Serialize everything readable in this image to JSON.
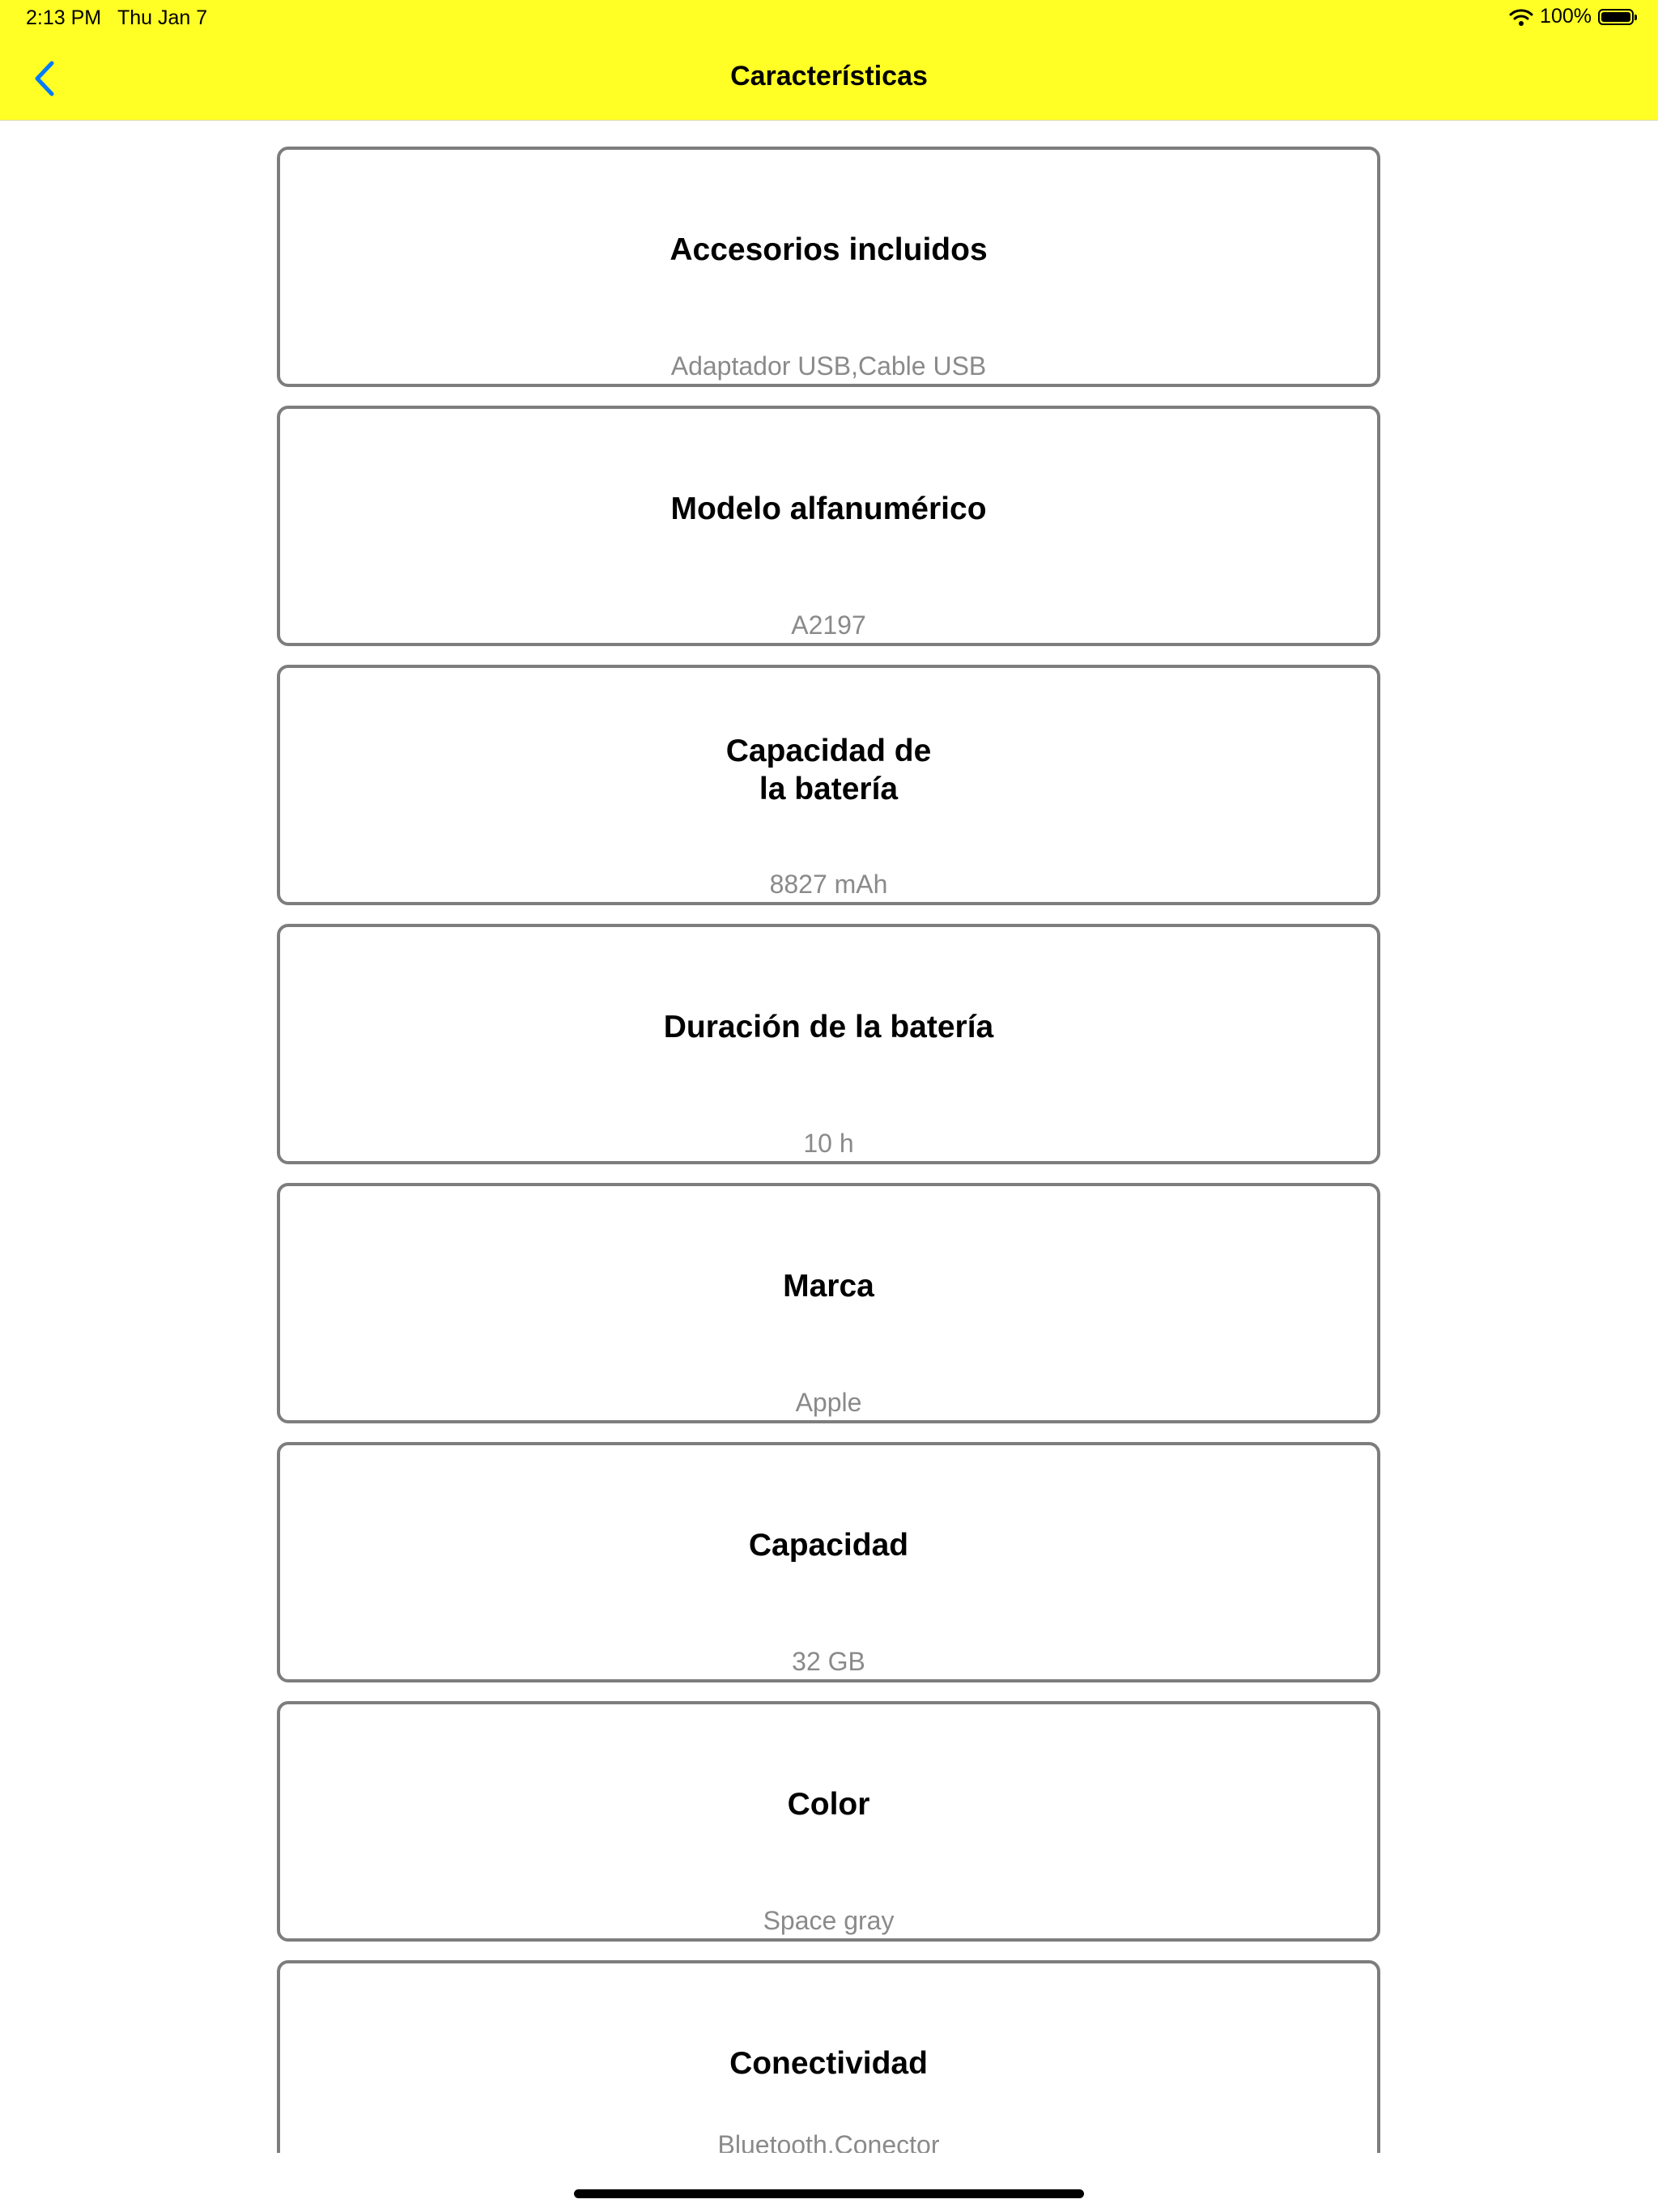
{
  "status_bar": {
    "time": "2:13 PM",
    "date": "Thu Jan 7",
    "battery": "100%",
    "battery_level": 1.0
  },
  "nav": {
    "title": "Características",
    "back_icon": "chevron-left-icon",
    "accent_color": "#007aff",
    "bar_color": "#ffff26"
  },
  "items": [
    {
      "title": "Accesorios incluidos",
      "value": "Adaptador USB,Cable USB"
    },
    {
      "title": "Modelo alfanumérico",
      "value": "A2197"
    },
    {
      "title": "Capacidad de\nla batería",
      "value": "8827 mAh"
    },
    {
      "title": "Duración de la batería",
      "value": "10 h"
    },
    {
      "title": "Marca",
      "value": "Apple"
    },
    {
      "title": "Capacidad",
      "value": "32 GB"
    },
    {
      "title": "Color",
      "value": "Space gray"
    },
    {
      "title": "Conectividad",
      "value": "Bluetooth,Conector\nlightning,Smart"
    }
  ]
}
